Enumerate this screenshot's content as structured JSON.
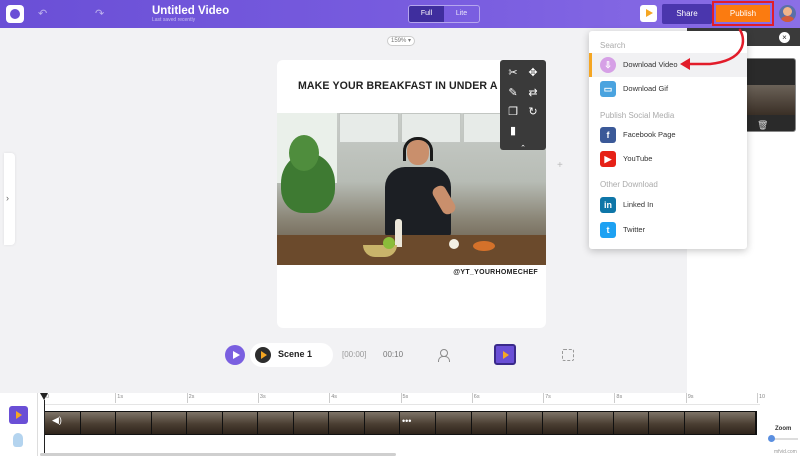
{
  "header": {
    "title": "Untitled Video",
    "subtitle": "Last saved recently",
    "toggle": {
      "full": "Full",
      "lite": "Lite"
    },
    "share_label": "Share",
    "publish_label": "Publish"
  },
  "canvas": {
    "zoom": "159% ▾",
    "heading": "MAKE YOUR BREAKFAST IN UNDER A MINUTE!!",
    "handle": "@YT_YOURHOMECHEF"
  },
  "playback": {
    "scene_label": "Scene 1",
    "time_start": "[00:00]",
    "time_end": "00:10"
  },
  "dropdown": {
    "sections": [
      "Search",
      "Publish Social Media",
      "Other Download"
    ],
    "items": [
      {
        "label": "Download Video",
        "icon": "download-video-icon"
      },
      {
        "label": "Download Gif",
        "icon": "download-gif-icon"
      },
      {
        "label": "Facebook Page",
        "icon": "facebook-icon"
      },
      {
        "label": "YouTube",
        "icon": "youtube-icon"
      },
      {
        "label": "Linked In",
        "icon": "linkedin-icon"
      },
      {
        "label": "Twitter",
        "icon": "twitter-icon"
      }
    ]
  },
  "timeline": {
    "ticks": [
      "0",
      "1s",
      "2s",
      "3s",
      "4s",
      "5s",
      "6s",
      "7s",
      "8s",
      "9s",
      "10"
    ],
    "zoom_label": "Zoom",
    "watermark": "mfvid.com"
  },
  "colors": {
    "header": "#6a4fd6",
    "publish": "#fb7b10",
    "highlight": "#e21c2a",
    "accent": "#f5a623"
  }
}
